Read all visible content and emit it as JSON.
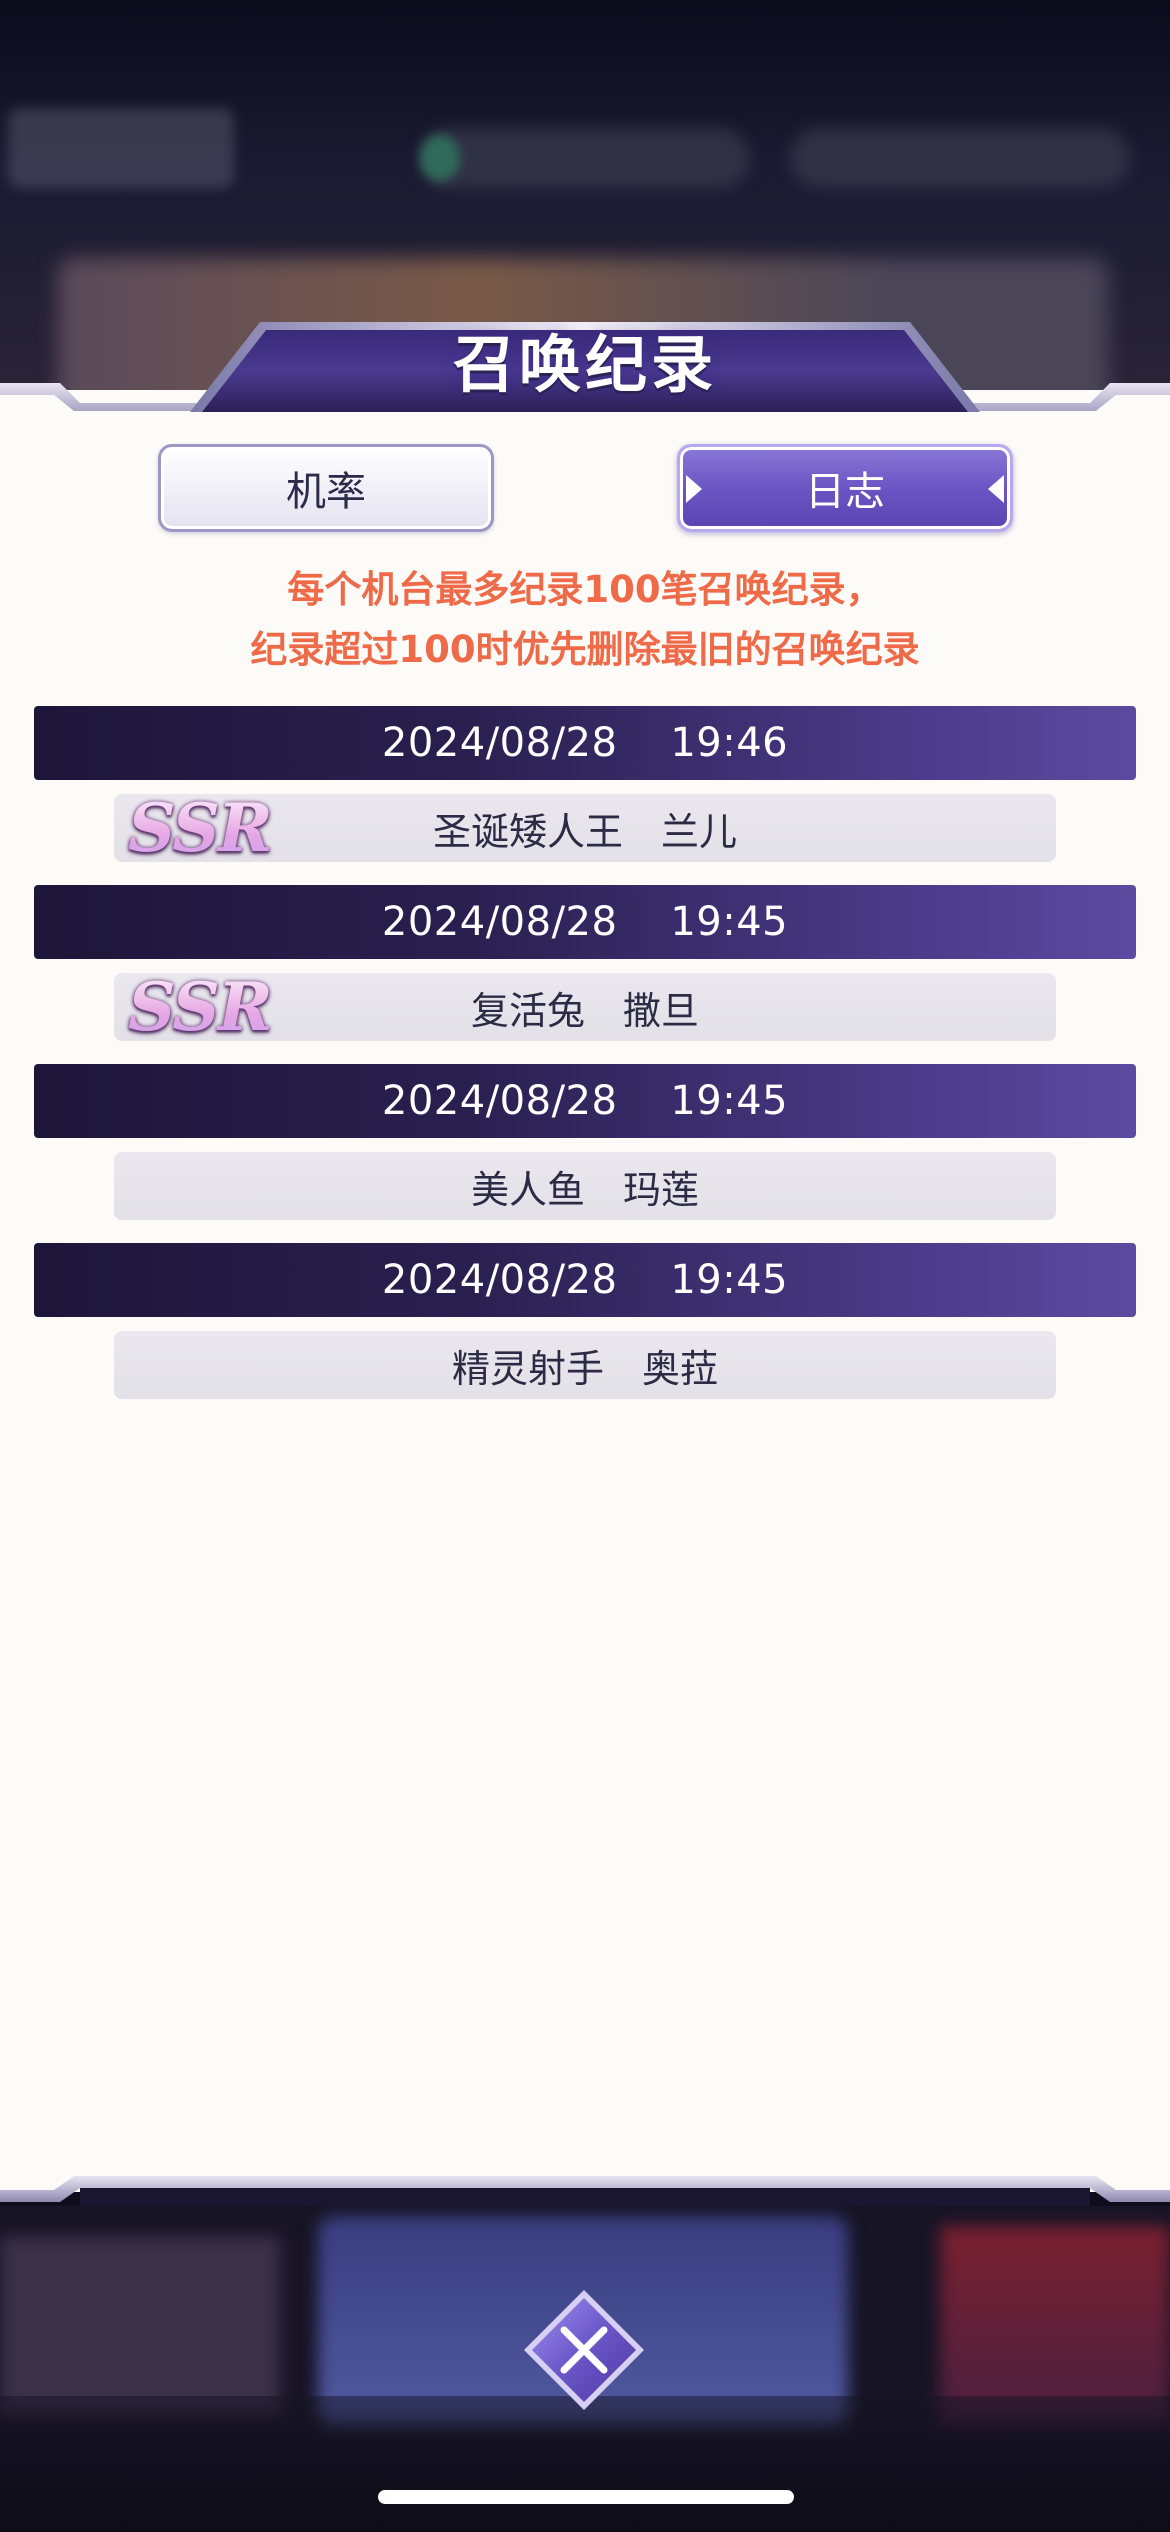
{
  "title": "召唤纪录",
  "tabs": {
    "probability": "机率",
    "log": "日志"
  },
  "notice": {
    "line1": "每个机台最多纪录100笔召唤纪录，",
    "line2": "纪录超过100时优先删除最旧的召唤纪录"
  },
  "records": [
    {
      "date": "2024/08/28",
      "time": "19:46",
      "rarity": "SSR",
      "name": "圣诞矮人王　兰儿"
    },
    {
      "date": "2024/08/28",
      "time": "19:45",
      "rarity": "SSR",
      "name": "复活兔　撒旦"
    },
    {
      "date": "2024/08/28",
      "time": "19:45",
      "rarity": "",
      "name": "美人鱼　玛莲"
    },
    {
      "date": "2024/08/28",
      "time": "19:45",
      "rarity": "",
      "name": "精灵射手　奥菈"
    }
  ],
  "colors": {
    "accent": "#6b55c4",
    "notice": "#ef6a48",
    "date_bar_dark": "#1d1639",
    "date_bar_light": "#5c4aa0",
    "panel_bg": "#fdfbf8"
  },
  "icons": {
    "close": "close-x-icon"
  }
}
